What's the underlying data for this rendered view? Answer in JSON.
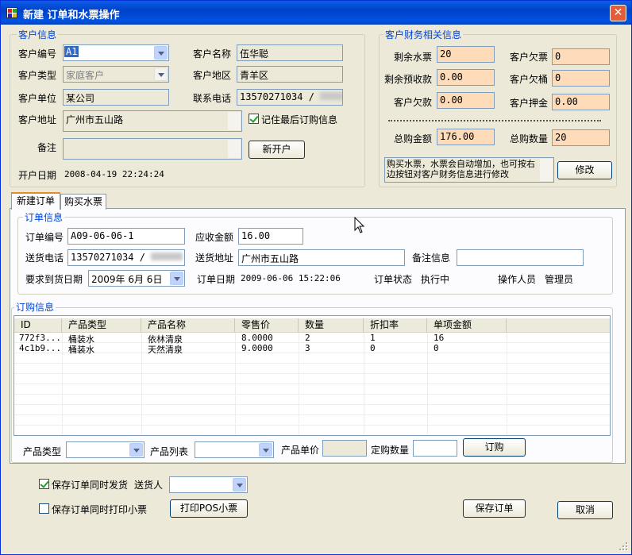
{
  "window": {
    "title": "新建 订单和水票操作",
    "close": "✕"
  },
  "customer": {
    "group_title": "客户信息",
    "id_label": "客户编号",
    "id_value": "A1",
    "name_label": "客户名称",
    "name_value": "伍华聪",
    "type_label": "客户类型",
    "type_value": "家庭客户",
    "region_label": "客户地区",
    "region_value": "青羊区",
    "unit_label": "客户单位",
    "unit_value": "某公司",
    "phone_label": "联系电话",
    "phone_value": "13570271034 / ",
    "address_label": "客户地址",
    "address_value": "广州市五山路",
    "remember_label": "记住最后订购信息",
    "note_label": "备注",
    "note_value": "",
    "new_account_button": "新开户",
    "open_date_label": "开户日期",
    "open_date_value": "2008-04-19 22:24:24"
  },
  "finance": {
    "group_title": "客户财务相关信息",
    "left_tickets_label": "剩余水票",
    "left_tickets_value": "20",
    "owe_tickets_label": "客户欠票",
    "owe_tickets_value": "0",
    "prepaid_label": "剩余预收款",
    "prepaid_value": "0.00",
    "owe_buckets_label": "客户欠桶",
    "owe_buckets_value": "0",
    "owe_money_label": "客户欠款",
    "owe_money_value": "0.00",
    "deposit_label": "客户押金",
    "deposit_value": "0.00",
    "total_amount_label": "总购金额",
    "total_amount_value": "176.00",
    "total_qty_label": "总购数量",
    "total_qty_value": "20",
    "hint": "购买水票，水票会自动增加，也可按右边按钮对客户财务信息进行修改",
    "modify_button": "修改"
  },
  "tabs": [
    {
      "label": "新建订单"
    },
    {
      "label": "购买水票"
    }
  ],
  "order": {
    "group_title": "订单信息",
    "no_label": "订单编号",
    "no_value": "A09-06-06-1",
    "receivable_label": "应收金额",
    "receivable_value": "16.00",
    "phone_label": "送货电话",
    "phone_value": "13570271034 / ",
    "addr_label": "送货地址",
    "addr_value": "广州市五山路",
    "remark_label": "备注信息",
    "remark_value": "",
    "required_date_label": "要求到货日期",
    "required_date_value": "2009年 6月 6日",
    "date_label": "订单日期",
    "date_value": "2009-06-06 15:22:06",
    "status_label": "订单状态",
    "status_value": "执行中",
    "operator_label": "操作人员",
    "operator_value": "管理员"
  },
  "items": {
    "group_title": "订购信息",
    "columns": [
      "ID",
      "产品类型",
      "产品名称",
      "零售价",
      "数量",
      "折扣率",
      "单项金额"
    ],
    "rows": [
      [
        "772f3...",
        "桶装水",
        "依林清泉",
        "8.0000",
        "2",
        "1",
        "16"
      ],
      [
        "4c1b9...",
        "桶装水",
        "天然清泉",
        "9.0000",
        "3",
        "0",
        "0"
      ]
    ]
  },
  "entry": {
    "type_label": "产品类型",
    "type_value": "",
    "list_label": "产品列表",
    "list_value": "",
    "price_label": "产品单价",
    "price_value": "",
    "qty_label": "定购数量",
    "qty_value": "",
    "order_button": "订购"
  },
  "bottom": {
    "ship_label": "保存订单同时发货",
    "courier_label": "送货人",
    "courier_value": "",
    "print_label": "保存订单同时打印小票",
    "pos_button": "打印POS小票",
    "save_button": "保存订单",
    "cancel_button": "取消"
  }
}
